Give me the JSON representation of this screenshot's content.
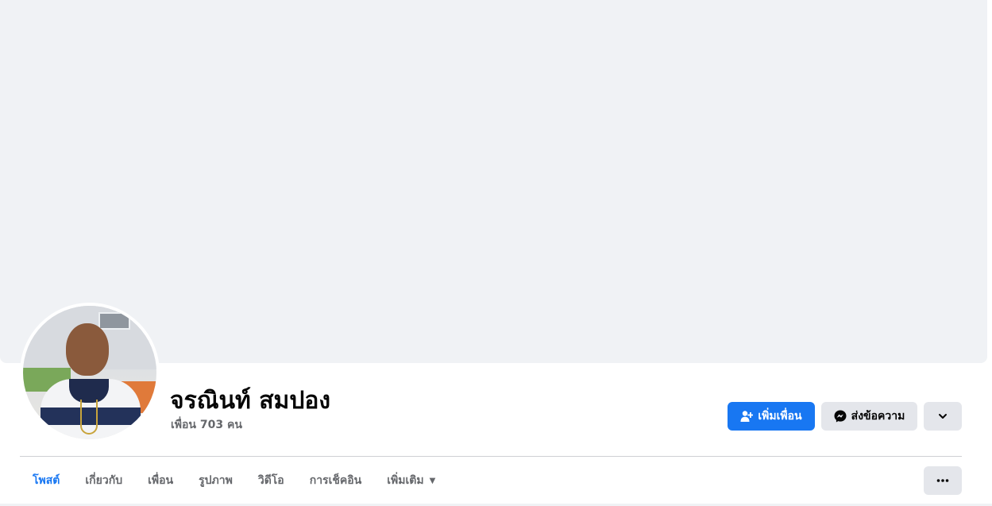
{
  "profile": {
    "name": "จรณินท์ สมปอง",
    "friends_text": "เพื่อน 703 คน"
  },
  "actions": {
    "add_friend_label": "เพิ่มเพื่อน",
    "message_label": "ส่งข้อความ",
    "more_icon": "chevron-down-icon"
  },
  "tabs": [
    {
      "label": "โพสต์",
      "active": true
    },
    {
      "label": "เกี่ยวกับ",
      "active": false
    },
    {
      "label": "เพื่อน",
      "active": false
    },
    {
      "label": "รูปภาพ",
      "active": false
    },
    {
      "label": "วิดีโอ",
      "active": false
    },
    {
      "label": "การเช็คอิน",
      "active": false
    },
    {
      "label": "เพิ่มเติม",
      "active": false
    }
  ],
  "tab_more_icon": "ellipsis-icon",
  "colors": {
    "accent": "#1877f2",
    "cover": "#f0f2f5",
    "secondary_button": "#e4e6eb",
    "muted_text": "#65676b"
  }
}
